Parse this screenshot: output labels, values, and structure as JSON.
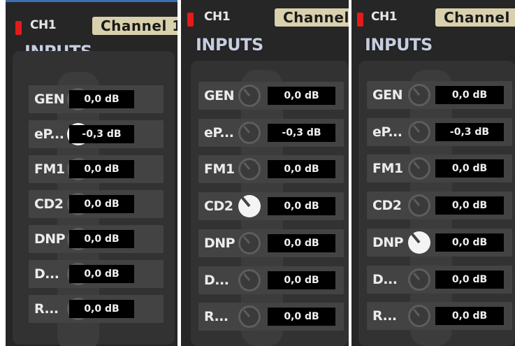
{
  "colors": {
    "led": "#e41b1b",
    "topline": "#3d6fb3",
    "name_tag": "#d9d1ad"
  },
  "panels": [
    {
      "channel": "CH1",
      "channel_name": "Channel 1",
      "section_title": "INPUTS",
      "inputs": [
        {
          "label": "GEN",
          "value": "0,0 dB",
          "active": false
        },
        {
          "label": "eP...",
          "value": "-0,3 dB",
          "active": true
        },
        {
          "label": "FM1",
          "value": "0,0 dB",
          "active": false
        },
        {
          "label": "CD2",
          "value": "0,0 dB",
          "active": false
        },
        {
          "label": "DNP",
          "value": "0,0 dB",
          "active": false
        },
        {
          "label": "D...",
          "value": "0,0 dB",
          "active": false
        },
        {
          "label": "R...",
          "value": "0,0 dB",
          "active": false
        }
      ]
    },
    {
      "channel": "CH1",
      "channel_name": "Channel",
      "section_title": "INPUTS",
      "inputs": [
        {
          "label": "GEN",
          "value": "0,0 dB",
          "active": false
        },
        {
          "label": "eP...",
          "value": "-0,3 dB",
          "active": false
        },
        {
          "label": "FM1",
          "value": "0,0 dB",
          "active": false
        },
        {
          "label": "CD2",
          "value": "0,0 dB",
          "active": true
        },
        {
          "label": "DNP",
          "value": "0,0 dB",
          "active": false
        },
        {
          "label": "D...",
          "value": "0,0 dB",
          "active": false
        },
        {
          "label": "R...",
          "value": "0,0 dB",
          "active": false
        }
      ]
    },
    {
      "channel": "CH1",
      "channel_name": "Channel",
      "section_title": "INPUTS",
      "inputs": [
        {
          "label": "GEN",
          "value": "0,0 dB",
          "active": false
        },
        {
          "label": "eP...",
          "value": "-0,3 dB",
          "active": false
        },
        {
          "label": "FM1",
          "value": "0,0 dB",
          "active": false
        },
        {
          "label": "CD2",
          "value": "0,0 dB",
          "active": false
        },
        {
          "label": "DNP",
          "value": "0,0 dB",
          "active": true
        },
        {
          "label": "D...",
          "value": "0,0 dB",
          "active": false
        },
        {
          "label": "R...",
          "value": "0,0 dB",
          "active": false
        }
      ]
    }
  ]
}
